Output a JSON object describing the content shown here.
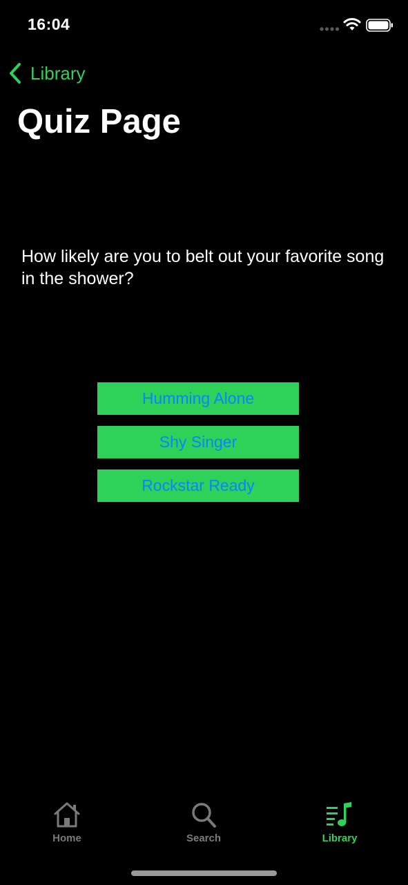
{
  "status_bar": {
    "time": "16:04",
    "signal_icon": "cellular-signal-icon",
    "wifi_icon": "wifi-icon",
    "battery_icon": "battery-icon"
  },
  "nav": {
    "back_label": "Library",
    "back_icon": "chevron-left-icon"
  },
  "page": {
    "title": "Quiz Page",
    "question": "How likely are you to belt out your favorite song in the shower?"
  },
  "answers": [
    {
      "label": "Humming Alone"
    },
    {
      "label": "Shy Singer"
    },
    {
      "label": "Rockstar Ready"
    }
  ],
  "tab_bar": {
    "tabs": [
      {
        "label": "Home",
        "icon": "home-icon",
        "active": false
      },
      {
        "label": "Search",
        "icon": "search-icon",
        "active": false
      },
      {
        "label": "Library",
        "icon": "music-library-icon",
        "active": true
      }
    ]
  },
  "colors": {
    "accent": "#30d158",
    "button_text": "#0a84ff",
    "background": "#000000",
    "inactive_tab": "#7a7a7a"
  }
}
